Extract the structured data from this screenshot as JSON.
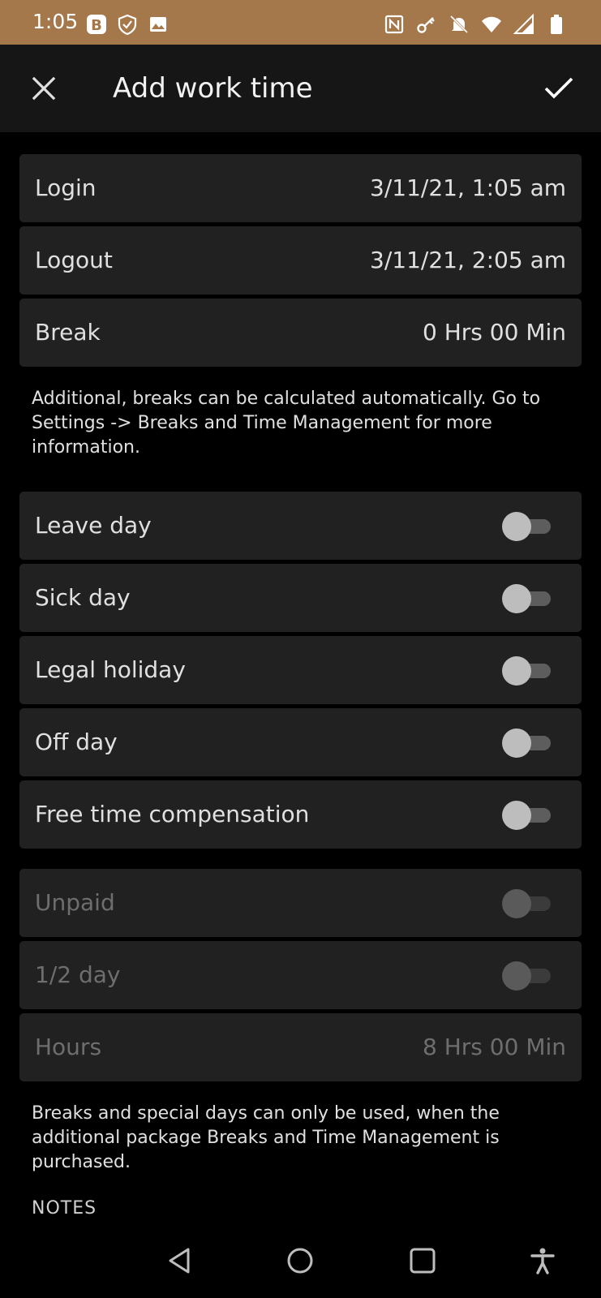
{
  "status_bar": {
    "time": "1:05",
    "left_icons": [
      "b-app-icon",
      "shield-check-icon",
      "image-icon"
    ],
    "right_icons": [
      "nfc-icon",
      "key-icon",
      "bell-off-icon",
      "wifi-icon",
      "signal-icon",
      "battery-icon"
    ],
    "background": "#a5784c"
  },
  "toolbar": {
    "title": "Add work time",
    "close_icon": "close-icon",
    "confirm_icon": "check-icon"
  },
  "time_rows": [
    {
      "label": "Login",
      "value": "3/11/21, 1:05 am"
    },
    {
      "label": "Logout",
      "value": "3/11/21, 2:05 am"
    },
    {
      "label": "Break",
      "value": "0 Hrs 00 Min"
    }
  ],
  "break_info": "Additional, breaks can be calculated automatically. Go to Settings -> Breaks and Time Management for more information.",
  "day_toggles": [
    {
      "label": "Leave day",
      "on": false
    },
    {
      "label": "Sick day",
      "on": false
    },
    {
      "label": "Legal holiday",
      "on": false
    },
    {
      "label": "Off day",
      "on": false
    },
    {
      "label": "Free time compensation",
      "on": false
    }
  ],
  "disabled_toggles": [
    {
      "label": "Unpaid",
      "on": false
    },
    {
      "label": "1/2 day",
      "on": false
    }
  ],
  "hours_row": {
    "label": "Hours",
    "value": "8 Hrs 00 Min"
  },
  "special_info": "Breaks and special days can only be used, when the additional package Breaks and Time Management is purchased.",
  "notes_heading": "NOTES",
  "colors": {
    "row_background": "#212121",
    "toolbar_background": "#161616",
    "disabled_text": "#6e6e6e"
  },
  "nav_bar": {
    "icons": [
      "back-icon",
      "home-icon",
      "recents-icon",
      "accessibility-icon"
    ]
  }
}
